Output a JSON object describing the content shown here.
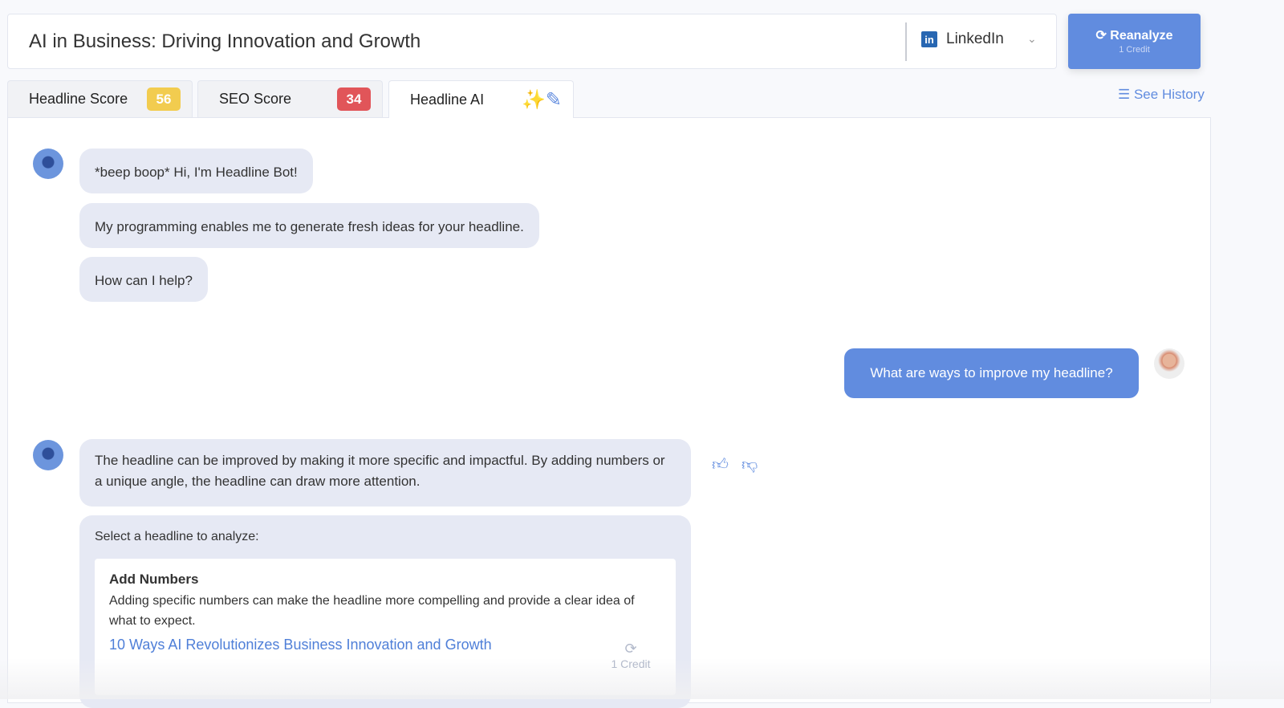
{
  "header": {
    "title": "AI in Business: Driving Innovation and Growth",
    "platform": "LinkedIn",
    "reanalyze_label": "Reanalyze",
    "reanalyze_cost": "1 Credit"
  },
  "tabs": [
    {
      "label": "Headline Score",
      "badge": "56",
      "badge_color": "#f2cc4f"
    },
    {
      "label": "SEO Score",
      "badge": "34",
      "badge_color": "#e15559"
    },
    {
      "label": "Headline AI"
    }
  ],
  "see_history": "See History",
  "chat": {
    "bot_intro": [
      "*beep boop* Hi, I'm Headline Bot!",
      "My programming enables me to generate fresh ideas for your headline.",
      "How can I help?"
    ],
    "user_message": "What are ways to improve my headline?",
    "bot_reply": "The headline can be improved by making it more specific and impactful. By adding numbers or a unique angle, the headline can draw more attention.",
    "select_prompt": "Select a headline to analyze:",
    "suggestion": {
      "title": "Add Numbers",
      "description": "Adding specific numbers can make the headline more compelling and provide a clear idea of what to expect.",
      "headline": "10 Ways AI Revolutionizes Business Innovation and Growth",
      "cost": "1 Credit"
    }
  }
}
